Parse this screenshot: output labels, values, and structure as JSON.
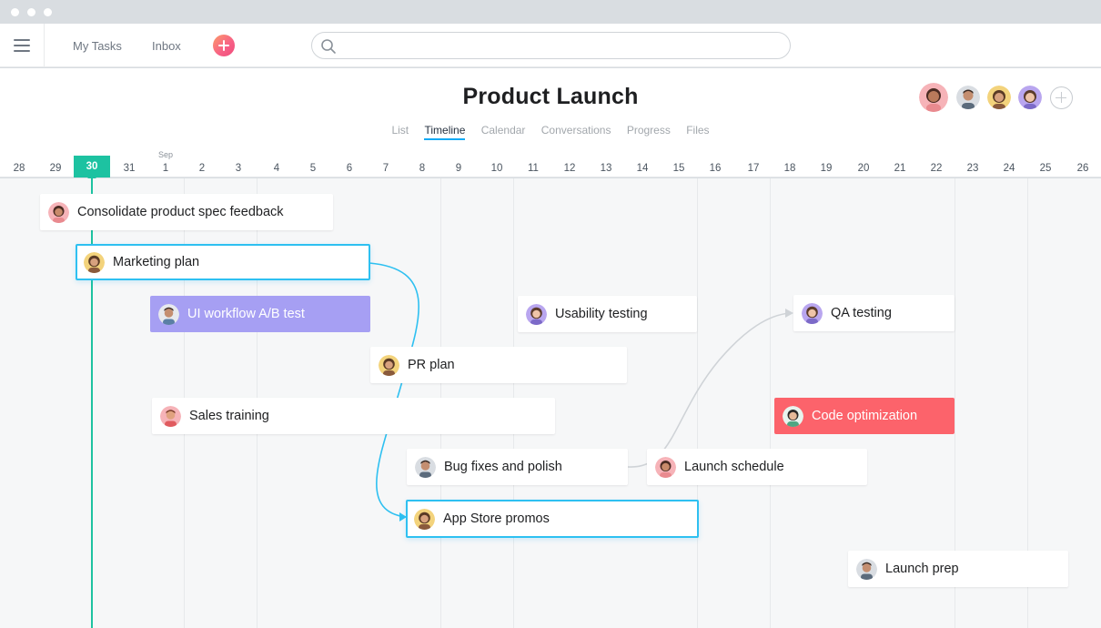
{
  "topbar": {
    "nav": [
      "My Tasks",
      "Inbox"
    ]
  },
  "project": {
    "title": "Product Launch",
    "tabs": [
      "List",
      "Timeline",
      "Calendar",
      "Conversations",
      "Progress",
      "Files"
    ],
    "active_tab": "Timeline"
  },
  "timeline": {
    "month_label": "Sep",
    "today": "30",
    "dates": [
      "28",
      "29",
      "30",
      "31",
      "1",
      "2",
      "3",
      "4",
      "5",
      "6",
      "7",
      "8",
      "9",
      "10",
      "11",
      "12",
      "13",
      "14",
      "15",
      "16",
      "17",
      "18",
      "19",
      "20",
      "21",
      "22",
      "23",
      "24",
      "25",
      "26"
    ]
  },
  "tasks": [
    {
      "name": "Consolidate product spec feedback",
      "style": "default"
    },
    {
      "name": "Marketing plan",
      "style": "selected"
    },
    {
      "name": "UI workflow A/B test",
      "style": "purple"
    },
    {
      "name": "Usability testing",
      "style": "default"
    },
    {
      "name": "QA testing",
      "style": "default"
    },
    {
      "name": "PR plan",
      "style": "default"
    },
    {
      "name": "Sales training",
      "style": "default"
    },
    {
      "name": "Code optimization",
      "style": "red"
    },
    {
      "name": "Bug fixes and polish",
      "style": "default"
    },
    {
      "name": "Launch schedule",
      "style": "default"
    },
    {
      "name": "App Store promos",
      "style": "selected"
    },
    {
      "name": "Launch prep",
      "style": "default"
    }
  ],
  "colors": {
    "accent": "#14aaf5",
    "today": "#1dc2a1",
    "purple_task": "#a69ff3",
    "red_task": "#fc636b"
  }
}
